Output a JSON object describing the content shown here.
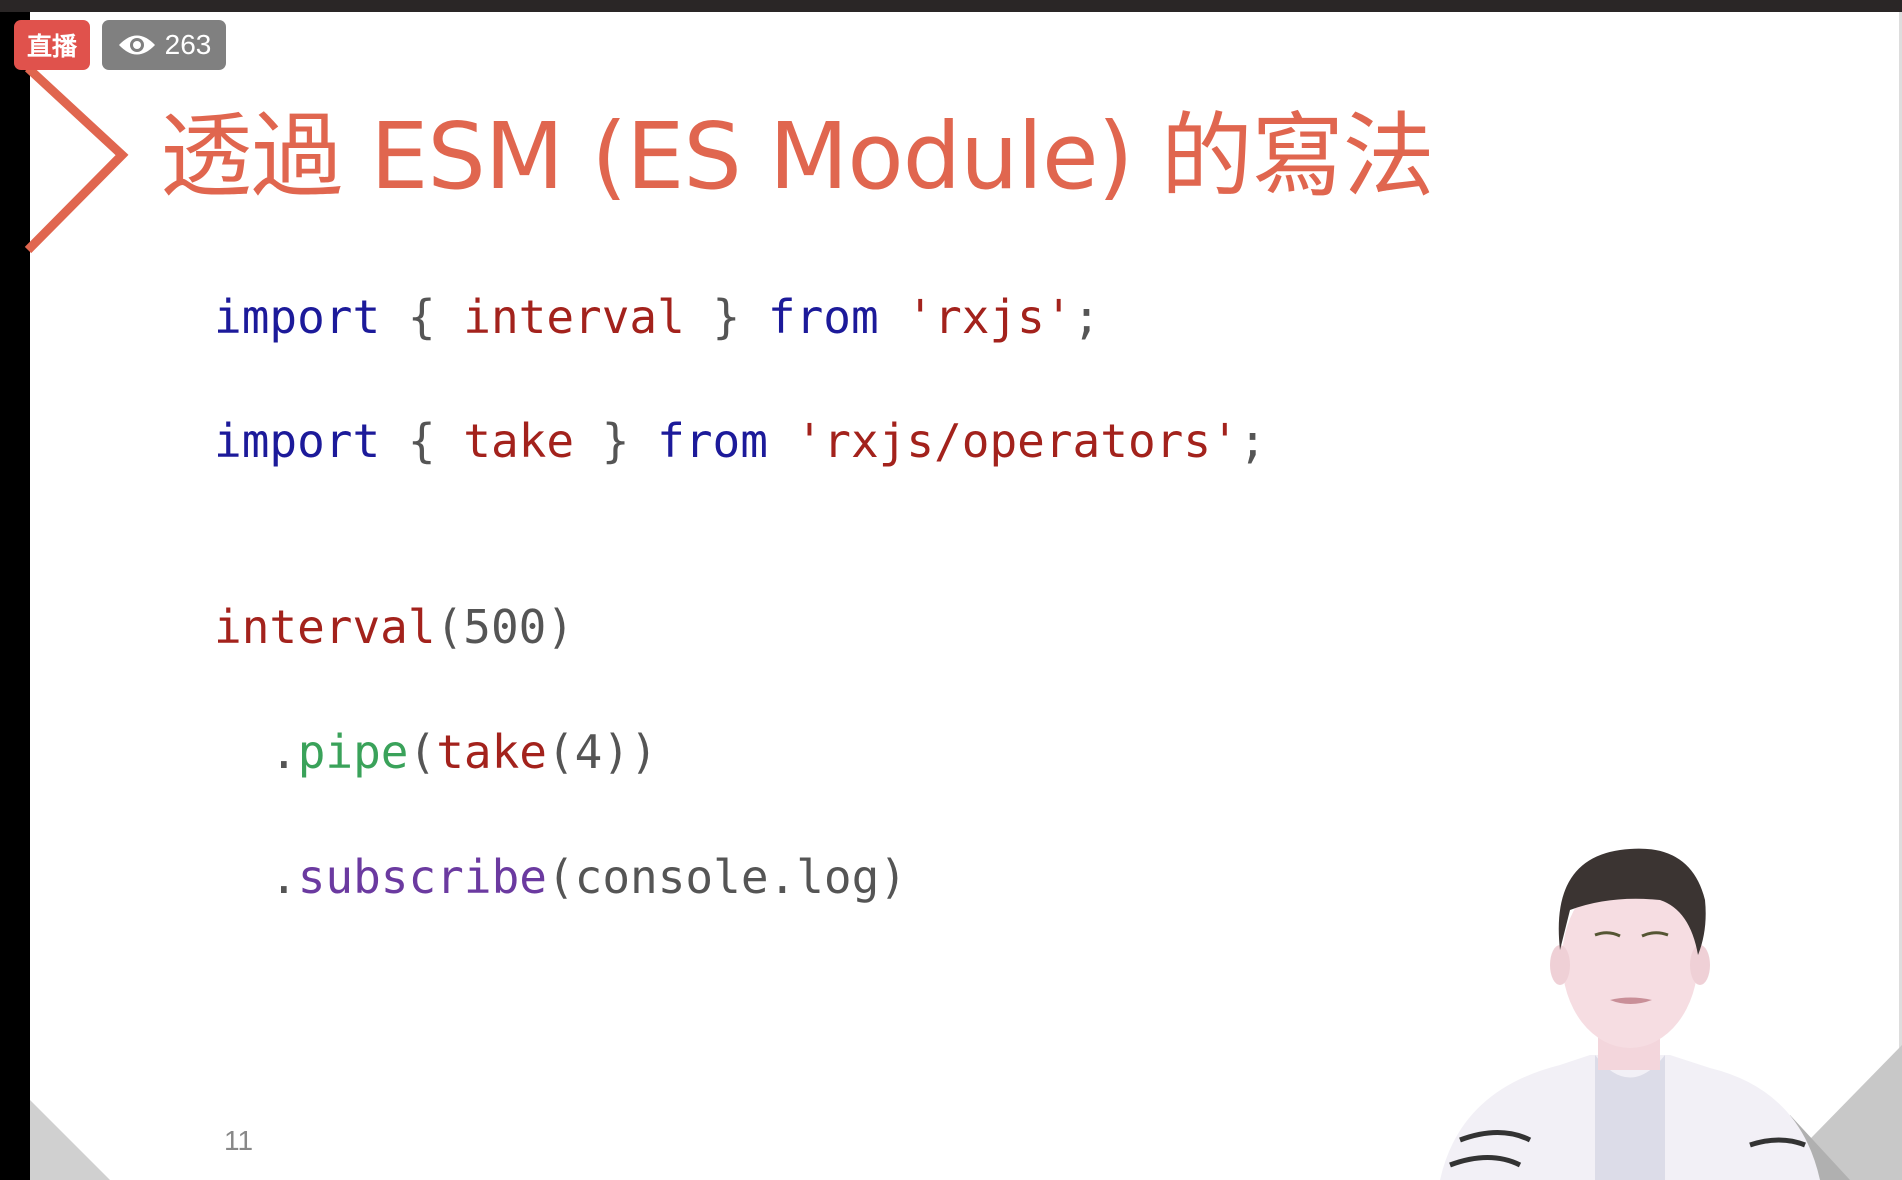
{
  "stream": {
    "live_label": "直播",
    "viewer_count": "263",
    "viewer_icon": "eye-icon"
  },
  "slide": {
    "title": "透過 ESM (ES Module) 的寫法",
    "page_number": "11",
    "code": {
      "line1": {
        "kw1": "import",
        "b1": " { ",
        "id": "interval",
        "b2": " } ",
        "kw2": "from",
        "str": " 'rxjs'",
        "end": ";"
      },
      "line2": {
        "kw1": "import",
        "b1": " { ",
        "id": "take",
        "b2": " } ",
        "kw2": "from",
        "str": " 'rxjs/operators'",
        "end": ";"
      },
      "line3": {
        "id": "interval",
        "args": "(500)"
      },
      "line4": {
        "dot": ".",
        "fn": "pipe",
        "open": "(",
        "id": "take",
        "args": "(4))"
      },
      "line5": {
        "dot": ".",
        "fn": "subscribe",
        "args": "(console.log)"
      }
    }
  },
  "colors": {
    "accent": "#e0664f",
    "keyword": "#1c1a9a",
    "identifier": "#a3221c"
  }
}
